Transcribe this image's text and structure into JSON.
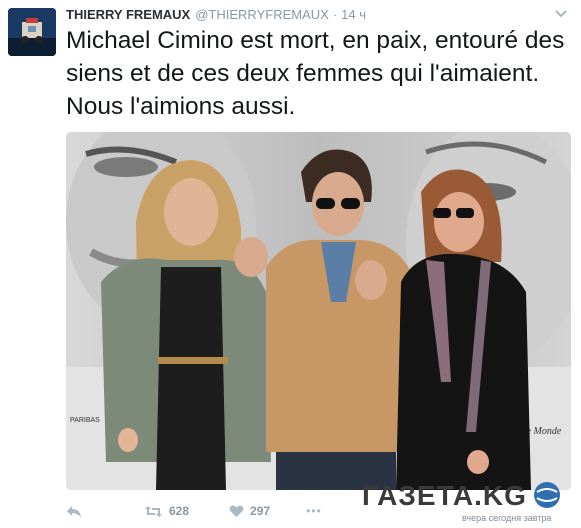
{
  "tweet": {
    "display_name": "THIERRY FREMAUX",
    "handle": "@THIERRYFREMAUX",
    "separator": "·",
    "timestamp": "14 ч",
    "text": "Michael Cimino est mort, en paix, entouré des siens et de ces deux femmes qui l'aimaient. Nous l'aimions aussi."
  },
  "media": {
    "sponsor_left": "PARIBAS",
    "sponsor_right": "Le Monde"
  },
  "actions": {
    "retweet_count": "628",
    "like_count": "297",
    "more_label": "•••"
  },
  "watermark": {
    "title": "ГАЗЕТА.KG",
    "subtitle": "вчера сегодня завтра"
  },
  "colors": {
    "link_gray": "#8899a6",
    "text": "#14171a",
    "icon": "#aab8c2"
  }
}
